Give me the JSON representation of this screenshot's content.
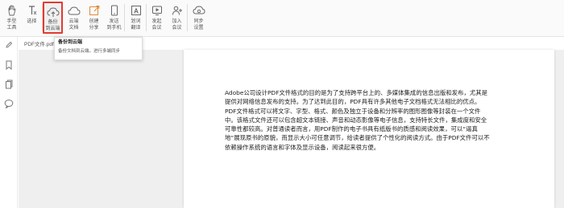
{
  "toolbar": {
    "tools": [
      {
        "label": "手型\n工具",
        "icon": "hand-icon"
      },
      {
        "label": "选择",
        "icon": "text-select-icon"
      },
      {
        "label": "备份\n到云端",
        "icon": "cloud-upload-icon"
      },
      {
        "label": "云端\n文档",
        "icon": "cloud-doc-icon"
      },
      {
        "label": "创建\n分享",
        "icon": "share-icon"
      },
      {
        "label": "发送\n到手机",
        "icon": "phone-icon"
      },
      {
        "label": "划词\n翻译",
        "icon": "translate-icon"
      },
      {
        "label": "发起\n会议",
        "icon": "meeting-icon"
      },
      {
        "label": "加入\n会议",
        "icon": "join-meeting-icon"
      },
      {
        "label": "同步\n设置",
        "icon": "sync-settings-icon"
      }
    ]
  },
  "tooltip": {
    "title": "备份到云端",
    "desc": "备份文档到云端，进行多端同步"
  },
  "tab": {
    "label": "PDF文件.pdf",
    "close": "×"
  },
  "document": {
    "body": "Adobe公司设计PDF文件格式的目的是为了支持跨平台上的、多媒体集成的信息出版和发布，尤其是提供对网络信息发布的支持。为了达到此目的，PDF具有许多其他电子文档格式无法相比的优点。PDF文件格式可以将文字、字型、格式、颜色及独立于设备和分辨率的图形图像等封装在一个文件中。该格式文件还可以包含超文本链接、声音和动态影像等电子信息，支持特长文件，集成度和安全可靠性都较高。对普通读者而言，用PDF制作的电子书具有纸版书的质感和阅读效果，可以“逼真地”展现原书的原貌，而显示大小可任意调节，给读者提供了个性化的阅读方式。由于PDF文件可以不依赖操作系统的语言和字体及显示设备，阅读起来很方便。"
  },
  "colors": {
    "highlight": "#e33b2f",
    "toolbar_bg": "#fafafa"
  }
}
